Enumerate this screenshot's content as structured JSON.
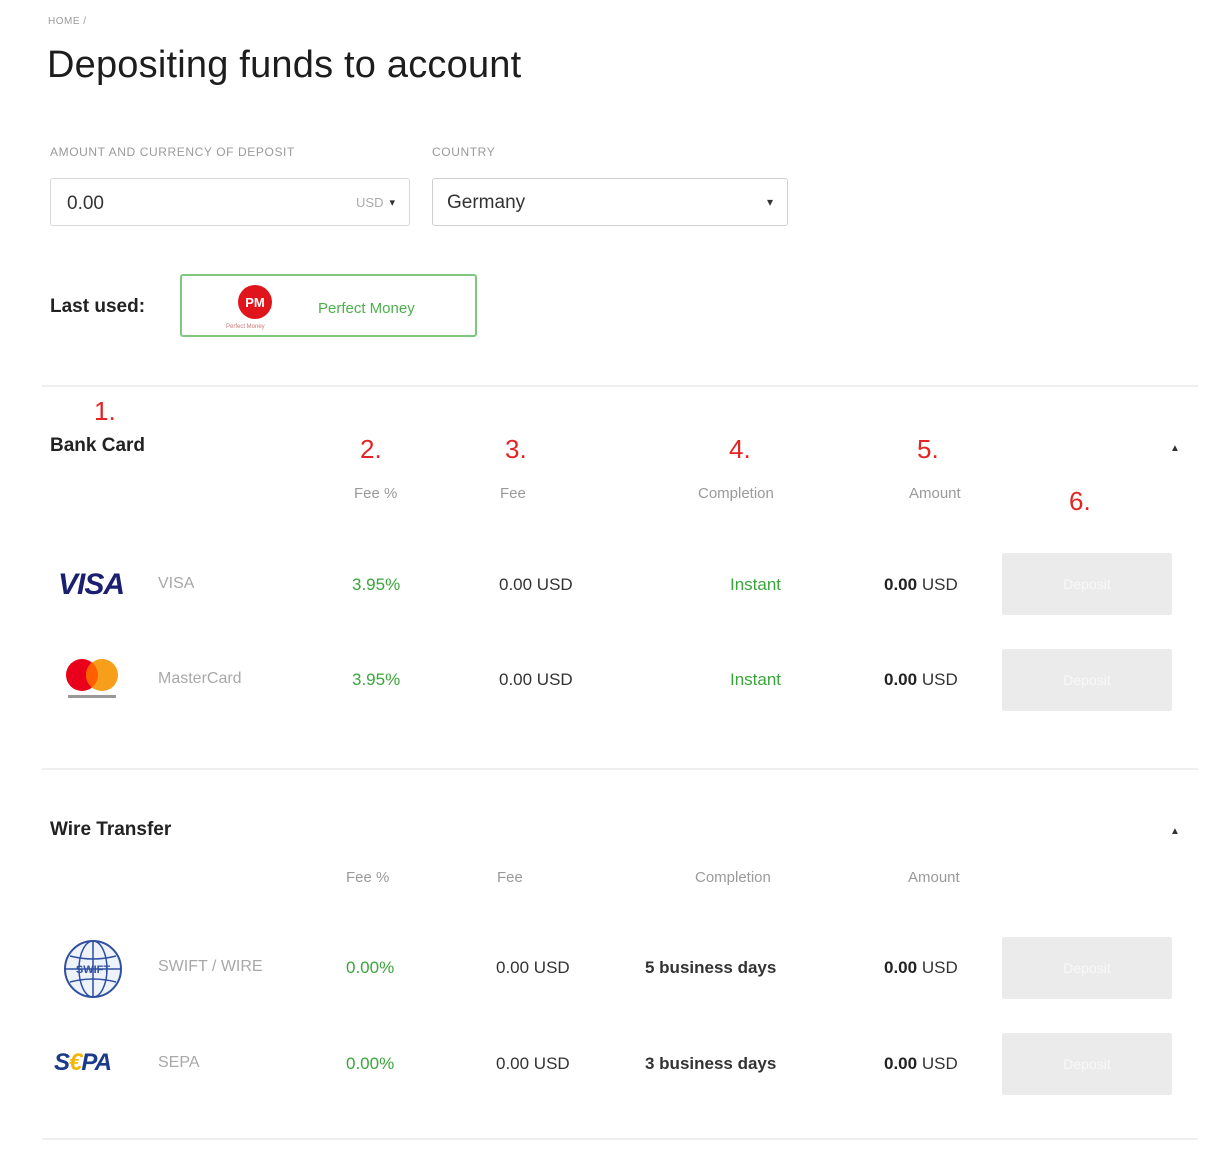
{
  "breadcrumb": "HOME /",
  "page_title": "Depositing funds to account",
  "deposit_form": {
    "amount_label": "AMOUNT AND CURRENCY OF DEPOSIT",
    "amount_value": "0.00",
    "currency_value": "USD",
    "country_label": "COUNTRY",
    "country_value": "Germany"
  },
  "last_used": {
    "label": "Last used:",
    "method_logo_text": "PM",
    "method_logo_caption": "Perfect Money",
    "method_name": "Perfect Money"
  },
  "annotations": [
    "1.",
    "2.",
    "3.",
    "4.",
    "5.",
    "6."
  ],
  "sections": [
    {
      "title": "Bank Card",
      "columns": [
        "Fee %",
        "Fee",
        "Completion",
        "Amount"
      ],
      "rows": [
        {
          "logo": "visa-logo",
          "logo_text": "VISA",
          "name": "VISA",
          "fee_pct": "3.95%",
          "fee": "0.00 USD",
          "completion": "Instant",
          "amount_num": "0.00",
          "amount_cur": "USD",
          "button": "Deposit"
        },
        {
          "logo": "mastercard-logo",
          "name": "MasterCard",
          "fee_pct": "3.95%",
          "fee": "0.00 USD",
          "completion": "Instant",
          "amount_num": "0.00",
          "amount_cur": "USD",
          "button": "Deposit"
        }
      ]
    },
    {
      "title": "Wire Transfer",
      "columns": [
        "Fee %",
        "Fee",
        "Completion",
        "Amount"
      ],
      "rows": [
        {
          "logo": "swift-logo",
          "logo_text": "SWIFT",
          "name": "SWIFT / WIRE",
          "fee_pct": "0.00%",
          "fee": "0.00 USD",
          "completion": "5 business days",
          "amount_num": "0.00",
          "amount_cur": "USD",
          "button": "Deposit"
        },
        {
          "logo": "sepa-logo",
          "logo_text_a": "S",
          "logo_text_euro": "€",
          "logo_text_b": "PA",
          "name": "SEPA",
          "fee_pct": "0.00%",
          "fee": "0.00 USD",
          "completion": "3 business days",
          "amount_num": "0.00",
          "amount_cur": "USD",
          "button": "Deposit"
        }
      ]
    }
  ],
  "colors": {
    "accent_green": "#3aa53a",
    "annotation_red": "#e32424",
    "button_disabled": "#ebebeb",
    "perfect_money_red": "#e0141b"
  }
}
